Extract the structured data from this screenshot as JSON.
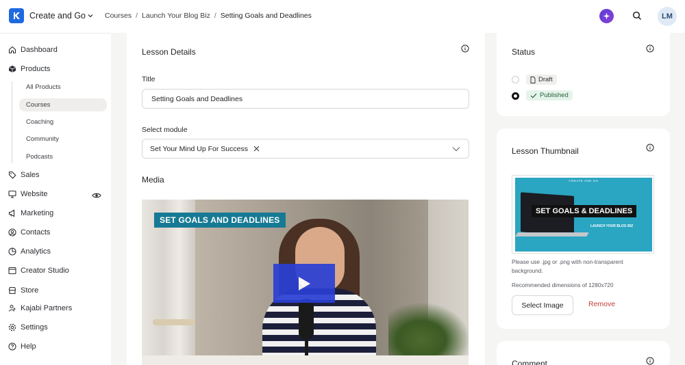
{
  "app": {
    "brand_name": "Create and Go",
    "user_initials": "LM",
    "accent_color": "#1e6ae1"
  },
  "breadcrumb": [
    "Courses",
    "Launch Your Blog Biz",
    "Setting Goals and Deadlines"
  ],
  "breadcrumb_sep": "/",
  "sidebar": {
    "items": [
      {
        "label": "Dashboard",
        "icon": "home-icon"
      },
      {
        "label": "Products",
        "icon": "box-icon"
      },
      {
        "label": "Sales",
        "icon": "tag-icon"
      },
      {
        "label": "Website",
        "icon": "monitor-icon"
      },
      {
        "label": "Marketing",
        "icon": "megaphone-icon"
      },
      {
        "label": "Contacts",
        "icon": "contacts-icon"
      },
      {
        "label": "Analytics",
        "icon": "analytics-icon"
      },
      {
        "label": "Creator Studio",
        "icon": "studio-icon"
      },
      {
        "label": "Store",
        "icon": "store-icon"
      },
      {
        "label": "Kajabi Partners",
        "icon": "partners-icon"
      },
      {
        "label": "Settings",
        "icon": "gear-icon"
      },
      {
        "label": "Help",
        "icon": "help-icon"
      }
    ],
    "product_subitems": [
      "All Products",
      "Courses",
      "Coaching",
      "Community",
      "Podcasts"
    ],
    "active_subitem": "Courses"
  },
  "lesson_details": {
    "heading": "Lesson Details",
    "title_label": "Title",
    "title_value": "Setting Goals and Deadlines",
    "module_label": "Select module",
    "module_value": "Set Your Mind Up For Success",
    "media_label": "Media",
    "video_overlay_text": "SET GOALS AND DEADLINES"
  },
  "status": {
    "heading": "Status",
    "options": [
      "Draft",
      "Published"
    ],
    "selected": "Published"
  },
  "thumbnail": {
    "heading": "Lesson Thumbnail",
    "image_brand": "CREATE AND GO",
    "image_title": "SET GOALS & DEADLINES",
    "image_subtitle": "LAUNCH YOUR BLOG BIZ",
    "help_text": "Please use .jpg or .png with non-transparent background.",
    "dimensions_text": "Recommended dimensions of 1280x720",
    "select_label": "Select Image",
    "remove_label": "Remove"
  },
  "comment": {
    "heading": "Comment"
  }
}
